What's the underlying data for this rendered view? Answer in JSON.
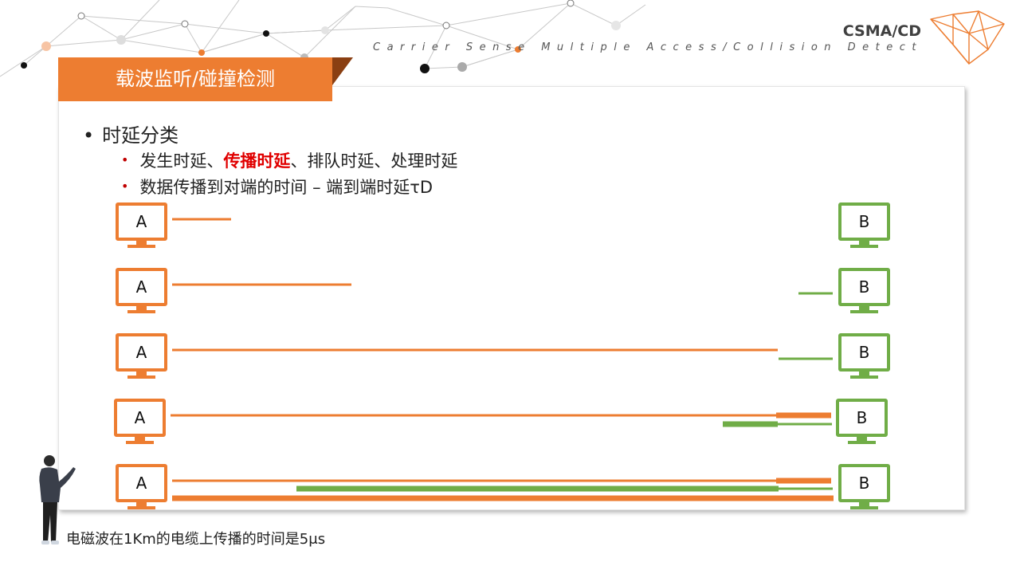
{
  "header": {
    "brand_title": "CSMA/CD",
    "brand_subtitle": "Carrier Sense Multiple Access/Collision Detection"
  },
  "slide": {
    "title": "载波监听/碰撞检测",
    "bullet_main": "时延分类",
    "bullet_sub1": {
      "before": "发生时延、",
      "highlight": "传播时延",
      "after": "、排队时延、处理时延"
    },
    "bullet_sub2": "数据传播到对端的时间 – 端到端时延τD"
  },
  "diagram": {
    "node_a": "A",
    "node_b": "B",
    "colors": {
      "a": "#ed7d31",
      "b": "#70ad47",
      "a_dark": "#8a3f12"
    },
    "stages": [
      {
        "signal_a_progress": 0.1,
        "signal_b_progress": 0.0,
        "collision": false
      },
      {
        "signal_a_progress": 0.3,
        "signal_b_progress": 0.05,
        "collision": false
      },
      {
        "signal_a_progress": 1.0,
        "signal_b_progress": 0.09,
        "collision": false
      },
      {
        "signal_a_progress": 1.0,
        "signal_b_progress": 0.18,
        "collision": true
      },
      {
        "signal_a_progress": 1.0,
        "signal_b_progress": 0.8,
        "collision": true
      }
    ]
  },
  "footnote": "电磁波在1Km的电缆上传播的时间是5μs"
}
